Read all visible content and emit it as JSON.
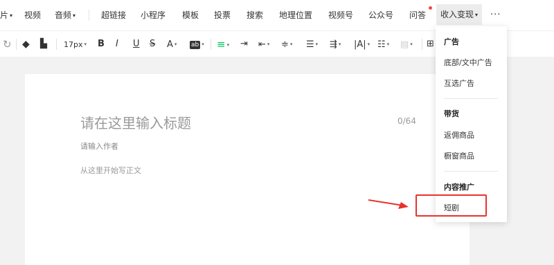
{
  "insert_bar": {
    "image": "片",
    "video": "视频",
    "audio": "音频",
    "hyperlink": "超链接",
    "miniprogram": "小程序",
    "template": "模板",
    "vote": "投票",
    "search": "搜索",
    "location": "地理位置",
    "channels": "视频号",
    "official_account": "公众号",
    "qa": "问答",
    "monetize": "收入变现",
    "more": "···"
  },
  "format_bar": {
    "font_size": "17px",
    "bold": "B",
    "italic": "I",
    "underline": "U",
    "strike": "S",
    "font_color": "A",
    "bg_color": "ab"
  },
  "editor": {
    "title_placeholder": "请在这里输入标题",
    "title_counter": "0/64",
    "author_placeholder": "请输入作者",
    "body_placeholder": "从这里开始写正文"
  },
  "dropdown": {
    "group_ads": "广告",
    "ad_bottom": "底部/文中广告",
    "ad_mutual": "互选广告",
    "group_goods": "带货",
    "goods_commission": "返佣商品",
    "goods_window": "橱窗商品",
    "group_promo": "内容推广",
    "promo_short_drama": "短剧"
  },
  "colors": {
    "accent": "#07c160",
    "highlight": "#e8322c"
  }
}
